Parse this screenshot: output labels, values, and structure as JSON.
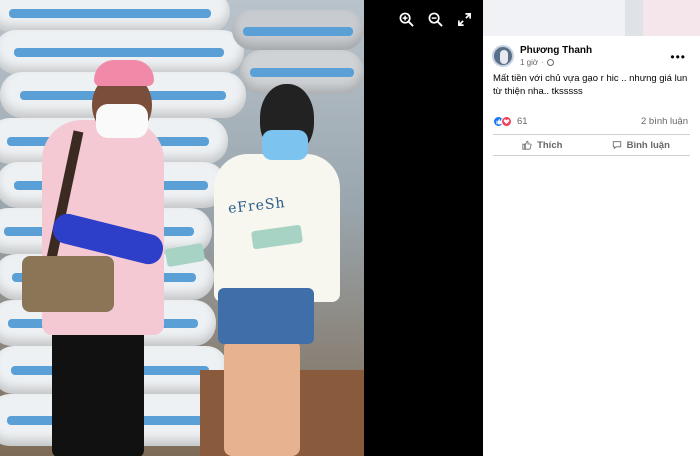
{
  "viewer": {
    "tools": [
      {
        "icon": "zoom-in-icon"
      },
      {
        "icon": "zoom-out-icon"
      },
      {
        "icon": "fullscreen-icon"
      }
    ],
    "photo_shirt_text": "eFreSh"
  },
  "post": {
    "author": "Phương Thanh",
    "time": "1 giờ",
    "privacy_icon": "globe-icon",
    "caption": "Mất tiền với chủ vựa gạo r hic .. nhưng giá lun từ thiện nha.. tksssss",
    "reaction_count": "61",
    "comment_count": "2 bình luận",
    "like_label": "Thích",
    "comment_label": "Bình luận",
    "more_label": "•••"
  },
  "colors": {
    "like_blue": "#1877f2",
    "love_red": "#f33e58",
    "text_secondary": "#65676b"
  }
}
